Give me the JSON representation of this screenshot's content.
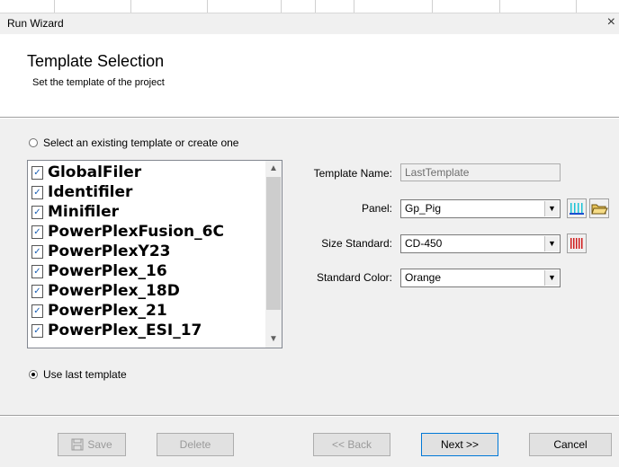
{
  "window": {
    "title": "Run Wizard",
    "close_glyph": "×"
  },
  "header": {
    "title": "Template Selection",
    "subtitle": "Set the template of the project"
  },
  "options": {
    "existing_label": "Select an existing template or create one",
    "last_label": "Use last template",
    "selected": "last"
  },
  "templates": [
    "GlobalFiler",
    "Identifiler",
    "Minifiler",
    "PowerPlexFusion_6C",
    "PowerPlexY23",
    "PowerPlex_16",
    "PowerPlex_18D",
    "PowerPlex_21",
    "PowerPlex_ESI_17"
  ],
  "form": {
    "template_name_label": "Template Name:",
    "template_name_value": "LastTemplate",
    "panel_label": "Panel:",
    "panel_value": "Gp_Pig",
    "size_standard_label": "Size Standard:",
    "size_standard_value": "CD-450",
    "standard_color_label": "Standard Color:",
    "standard_color_value": "Orange"
  },
  "icons": {
    "panel_chart": "panel-chart-icon",
    "open_folder": "open-folder-icon",
    "size_standard_chart": "size-standard-chart-icon",
    "save": "save-disk-icon",
    "list_checkbox": "checkbox-icon"
  },
  "buttons": {
    "save": "Save",
    "delete": "Delete",
    "back": "<< Back",
    "next": "Next >>",
    "cancel": "Cancel"
  }
}
